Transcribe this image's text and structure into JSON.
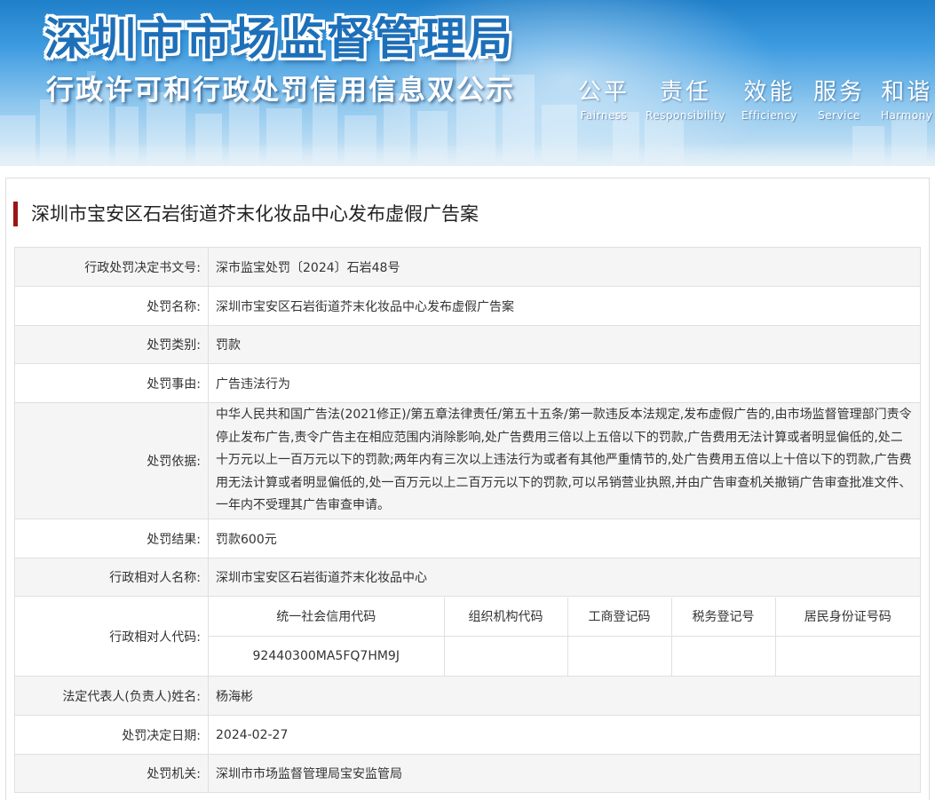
{
  "banner": {
    "title": "深圳市市场监督管理局",
    "subtitle": "行政许可和行政处罚信用信息双公示",
    "slogans": [
      {
        "cn": "公平",
        "en": "Fairness"
      },
      {
        "cn": "责任",
        "en": "Responsibility"
      },
      {
        "cn": "效能",
        "en": "Efficiency"
      },
      {
        "cn": "服务",
        "en": "Service"
      },
      {
        "cn": "和谐",
        "en": "Harmony"
      }
    ]
  },
  "case": {
    "title": "深圳市宝安区石岩街道芥末化妆品中心发布虚假广告案"
  },
  "details": {
    "decision_no": {
      "label": "行政处罚决定书文号:",
      "value": "深市监宝处罚〔2024〕石岩48号"
    },
    "penalty_name": {
      "label": "处罚名称:",
      "value": "深圳市宝安区石岩街道芥末化妆品中心发布虚假广告案"
    },
    "penalty_type": {
      "label": "处罚类别:",
      "value": "罚款"
    },
    "penalty_reason": {
      "label": "处罚事由:",
      "value": "广告违法行为"
    },
    "penalty_basis": {
      "label": "处罚依据:",
      "value": "中华人民共和国广告法(2021修正)/第五章法律责任/第五十五条/第一款违反本法规定,发布虚假广告的,由市场监督管理部门责令停止发布广告,责令广告主在相应范围内消除影响,处广告费用三倍以上五倍以下的罚款,广告费用无法计算或者明显偏低的,处二十万元以上一百万元以下的罚款;两年内有三次以上违法行为或者有其他严重情节的,处广告费用五倍以上十倍以下的罚款,广告费用无法计算或者明显偏低的,处一百万元以上二百万元以下的罚款,可以吊销营业执照,并由广告审查机关撤销广告审查批准文件、一年内不受理其广告审查申请。"
    },
    "penalty_result": {
      "label": "处罚结果:",
      "value": "罚款600元"
    },
    "party_name": {
      "label": "行政相对人名称:",
      "value": "深圳市宝安区石岩街道芥末化妆品中心"
    },
    "party_code": {
      "label": "行政相对人代码:",
      "headers": [
        "统一社会信用代码",
        "组织机构代码",
        "工商登记码",
        "税务登记号",
        "居民身份证号码"
      ],
      "values": [
        "92440300MA5FQ7HM9J",
        "",
        "",
        "",
        ""
      ]
    },
    "legal_rep": {
      "label": "法定代表人(负责人)姓名:",
      "value": "杨海彬"
    },
    "decision_date": {
      "label": "处罚决定日期:",
      "value": "2024-02-27"
    },
    "authority": {
      "label": "处罚机关:",
      "value": "深圳市市场监督管理局宝安监管局"
    }
  },
  "colors": {
    "accent": "#9b1515",
    "banner_blue": "#1d6fb8",
    "row_alt": "#f5f5f5",
    "border": "#e0e0e0"
  }
}
